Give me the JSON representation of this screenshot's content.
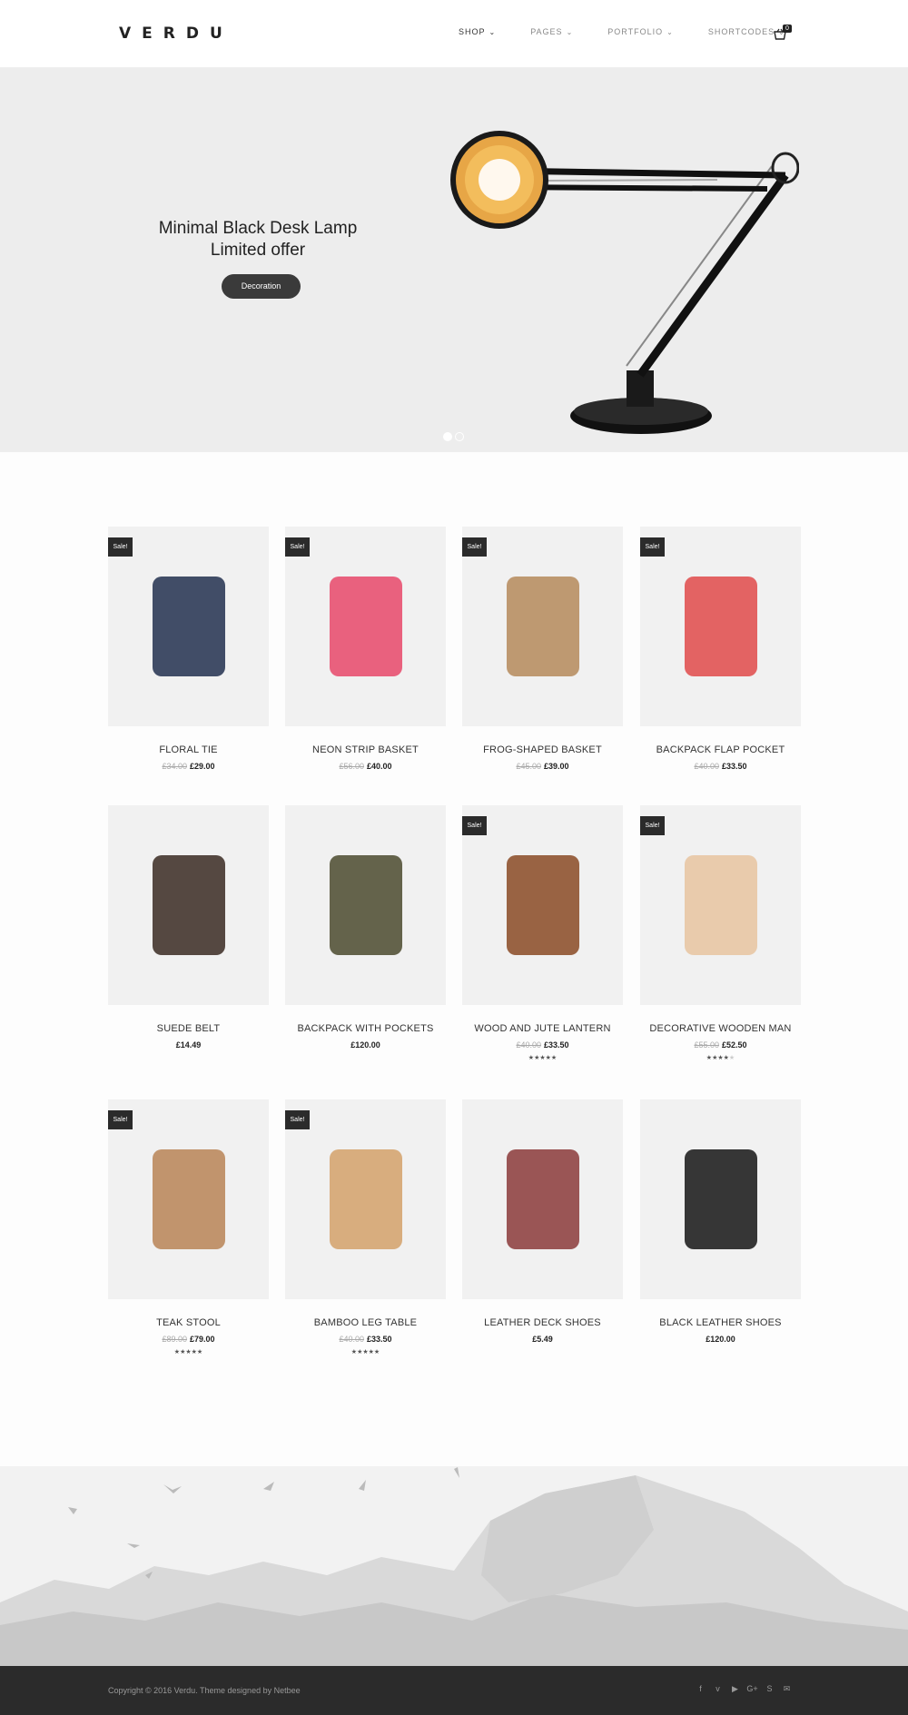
{
  "header": {
    "logo": "VERDU",
    "nav": [
      {
        "label": "SHOP"
      },
      {
        "label": "PAGES"
      },
      {
        "label": "PORTFOLIO"
      },
      {
        "label": "SHORTCODES"
      }
    ],
    "cart_count": "0"
  },
  "hero": {
    "title_line1": "Minimal Black Desk Lamp",
    "title_line2": "Limited offer",
    "button": "Decoration",
    "slides": 2,
    "active_slide": 1
  },
  "products": [
    {
      "name": "FLORAL TIE",
      "old_price": "£34.00",
      "price": "£29.00",
      "sale": "Sale!",
      "rating": 0
    },
    {
      "name": "NEON STRIP BASKET",
      "old_price": "£56.00",
      "price": "£40.00",
      "sale": "Sale!",
      "rating": 0
    },
    {
      "name": "FROG-SHAPED BASKET",
      "old_price": "£45.00",
      "price": "£39.00",
      "sale": "Sale!",
      "rating": 0
    },
    {
      "name": "BACKPACK FLAP POCKET",
      "old_price": "£40.00",
      "price": "£33.50",
      "sale": "Sale!",
      "rating": 0
    },
    {
      "name": "SUEDE BELT",
      "old_price": "",
      "price": "£14.49",
      "sale": "",
      "rating": 0
    },
    {
      "name": "BACKPACK WITH POCKETS",
      "old_price": "",
      "price": "£120.00",
      "sale": "",
      "rating": 0
    },
    {
      "name": "WOOD AND JUTE LANTERN",
      "old_price": "£40.00",
      "price": "£33.50",
      "sale": "Sale!",
      "rating": 5
    },
    {
      "name": "DECORATIVE WOODEN MAN",
      "old_price": "£55.00",
      "price": "£52.50",
      "sale": "Sale!",
      "rating": 4
    },
    {
      "name": "TEAK STOOL",
      "old_price": "£89.00",
      "price": "£79.00",
      "sale": "Sale!",
      "rating": 5
    },
    {
      "name": "BAMBOO LEG TABLE",
      "old_price": "£40.00",
      "price": "£33.50",
      "sale": "Sale!",
      "rating": 5
    },
    {
      "name": "LEATHER DECK SHOES",
      "old_price": "",
      "price": "£5.49",
      "sale": "",
      "rating": 0
    },
    {
      "name": "BLACK LEATHER SHOES",
      "old_price": "",
      "price": "£120.00",
      "sale": "",
      "rating": 0
    }
  ],
  "footer": {
    "copyright": "Copyright © 2016 Verdu. Theme designed by Netbee",
    "social": [
      {
        "icon": "facebook-icon",
        "glyph": "f"
      },
      {
        "icon": "vimeo-icon",
        "glyph": "v"
      },
      {
        "icon": "youtube-icon",
        "glyph": "▶"
      },
      {
        "icon": "google-plus-icon",
        "glyph": "G+"
      },
      {
        "icon": "skype-icon",
        "glyph": "S"
      },
      {
        "icon": "mail-icon",
        "glyph": "✉"
      }
    ]
  }
}
